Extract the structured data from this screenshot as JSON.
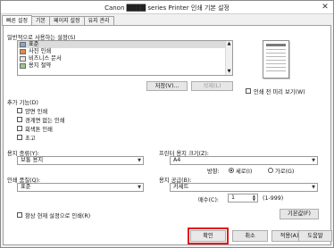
{
  "window": {
    "title": "Canon ████ series Printer 인쇄 기본 설정",
    "close_glyph": "✕"
  },
  "tabs": [
    {
      "label": "빠른 설정"
    },
    {
      "label": "기본"
    },
    {
      "label": "페이지 설정"
    },
    {
      "label": "유지 관리"
    }
  ],
  "presets": {
    "heading": "일반적으로 사용하는 설정(S)",
    "items": [
      {
        "label": "표준",
        "icon": "printer-icon"
      },
      {
        "label": "사진 인쇄",
        "icon": "photo-icon"
      },
      {
        "label": "비즈니스 문서",
        "icon": "document-icon"
      },
      {
        "label": "용지 절약",
        "icon": "paper-save-icon"
      }
    ],
    "save_button": "저장(V)...",
    "delete_button": "삭제(L)"
  },
  "preview": {
    "always_preview_label": "인쇄 전 미리 보기(W)"
  },
  "additional": {
    "heading": "추가 기능(D)",
    "options": [
      {
        "label": "양면 인쇄"
      },
      {
        "label": "경계면 없는 인쇄"
      },
      {
        "label": "회색톤 인쇄"
      },
      {
        "label": "초고"
      }
    ]
  },
  "media_type": {
    "label": "용지 종류(Y):",
    "value": "보통 용지"
  },
  "paper_size": {
    "label": "프린터 용지 크기(Z):",
    "value": "A4"
  },
  "orientation": {
    "label": "방향:",
    "portrait": "세로(I)",
    "landscape": "가로(G)"
  },
  "print_quality": {
    "label": "인쇄 품질(Q):",
    "value": "표준"
  },
  "paper_source": {
    "label": "용지 공급(B):",
    "value": "카세트"
  },
  "copies": {
    "label": "매수(C):",
    "value": "1",
    "range": "(1-999)"
  },
  "always_print_current": {
    "label": "항상 현재 설정으로 인쇄(R)"
  },
  "defaults_button": "기본값(F)",
  "footer": {
    "ok": "확인",
    "cancel": "취소",
    "apply": "적용(A)",
    "help": "도움말"
  },
  "colors": {
    "highlight_border": "#e0191b",
    "accent": "#0066cc"
  }
}
